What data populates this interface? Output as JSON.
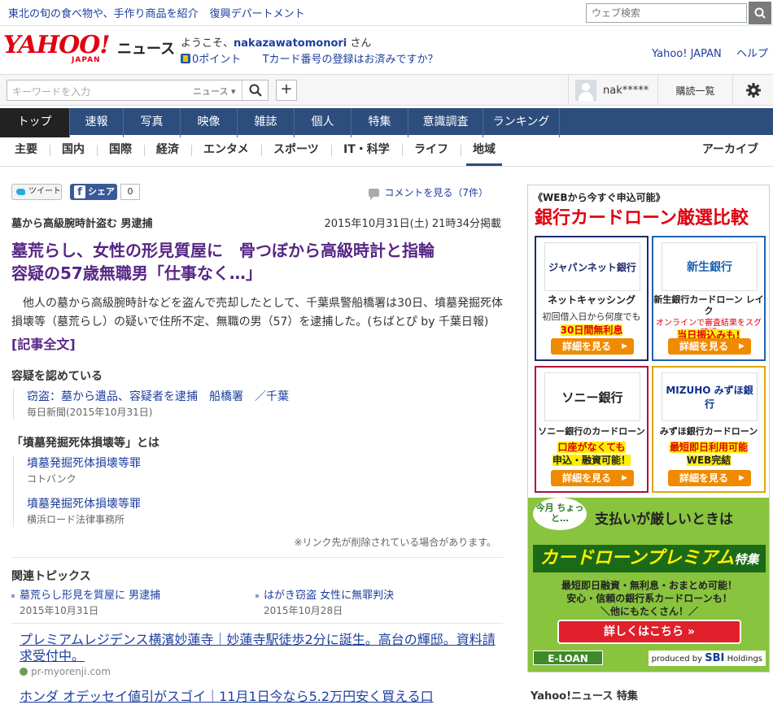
{
  "promo": {
    "text": "東北の旬の食べ物や、手作り商品を紹介",
    "link": "復興デパートメント"
  },
  "web_search": {
    "placeholder": "ウェブ検索"
  },
  "header": {
    "logo": "YAHOO!",
    "logo_sub": "JAPAN",
    "section": "ニュース",
    "welcome_prefix": "ようこそ、",
    "username": "nakazawatomonori",
    "welcome_suffix": " さん",
    "points": "0ポイント",
    "tcard": "Tカード番号の登録はお済みですか？",
    "links": [
      "Yahoo! JAPAN",
      "ヘルプ"
    ]
  },
  "toolbar": {
    "keyword_placeholder": "キーワードを入力",
    "category": "ニュース ▾",
    "user": "nak*****",
    "subscriptions": "購読一覧"
  },
  "nav": [
    {
      "label": "トップ",
      "w": 0
    },
    {
      "label": "速報"
    },
    {
      "label": "写真"
    },
    {
      "label": "映像"
    },
    {
      "label": "雑誌"
    },
    {
      "label": "個人"
    },
    {
      "label": "特集"
    },
    {
      "label": "意識調査"
    },
    {
      "label": "ランキング"
    }
  ],
  "subnav": [
    "主要",
    "国内",
    "国際",
    "経済",
    "エンタメ",
    "スポーツ",
    "IT・科学",
    "ライフ",
    "地域"
  ],
  "archive": "アーカイブ",
  "share": {
    "tweet": "ツイート",
    "facebook": "シェア",
    "fb_count": "0",
    "comments": "コメントを見る（7件）"
  },
  "article": {
    "kicker": "墓から高級腕時計盗む 男逮捕",
    "date": "2015年10月31日(土) 21時34分掲載",
    "title_line1": "墓荒らし、女性の形見質屋に　骨つぼから高級時計と指輪",
    "title_line2": "容疑の57歳無職男「仕事なく…」",
    "lead": "他人の墓から高級腕時計などを盗んで売却したとして、千葉県警船橋署は30日、墳墓発掘死体損壊等（墓荒らし）の疑いで住所不定、無職の男（57）を逮捕した。(ちばとぴ by 千葉日報)",
    "full_link": "[記事全文]"
  },
  "related": [
    {
      "heading": "容疑を認めている",
      "items": [
        {
          "link": "窃盗：墓から遺品、容疑者を逮捕　船橋署　／千葉",
          "source": "毎日新聞(2015年10月31日)"
        }
      ]
    },
    {
      "heading": "「墳墓発掘死体損壊等」とは",
      "items": [
        {
          "link": "墳墓発掘死体損壊等罪",
          "source": "コトバンク"
        },
        {
          "link": "墳墓発掘死体損壊等罪",
          "source": "横浜ロード法律事務所"
        }
      ]
    }
  ],
  "note": "※リンク先が削除されている場合があります。",
  "topics": {
    "heading": "関連トピックス",
    "items": [
      {
        "title": "墓荒らし形見を質屋に 男逮捕",
        "date": "2015年10月31日"
      },
      {
        "title": "はがき窃盗 女性に無罪判決",
        "date": "2015年10月28日"
      }
    ]
  },
  "ads": {
    "ad1_title": "プレミアムレジデンス横濱妙蓮寺｜妙蓮寺駅徒歩2分に誕生。高台の輝邸。資料請求受付中。",
    "ad1_url": "pr-myorenji.com",
    "ad2_title": "ホンダ オデッセイ値引がスゴイ｜11月1日今なら5.2万円安く買える口"
  },
  "side_ad": {
    "tag": "《WEBから今すぐ申込可能》",
    "headline": "銀行カードローン厳選比較",
    "cards": [
      {
        "logo": "ジャパンネット銀行",
        "name": "ネットキャッシング",
        "d1": "初回借入日から何度でも",
        "d2": "30日間無利息",
        "btn": "詳細を見る",
        "color": "#1d2a6b"
      },
      {
        "logo": "新生銀行",
        "name": "新生銀行カードローン レイク",
        "d1": "オンラインで審査結果をスグ確認",
        "d2": "当日振込みも!",
        "btn": "詳細を見る",
        "color": "#1d63b0"
      },
      {
        "logo": "ソニー銀行",
        "name": "ソニー銀行のカードローン",
        "d1": "口座がなくても",
        "d2": "申込・融資可能！",
        "btn": "詳細を見る",
        "color": "#b0103a"
      },
      {
        "logo": "MIZUHO みずほ銀行",
        "name": "みずほ銀行カードローン",
        "d1": "最短即日利用可能",
        "d2": "WEB完結",
        "btn": "詳細を見る",
        "color": "#e0a800"
      }
    ],
    "bubble": "今月 ちょっと…",
    "pay": "支払いが厳しいときは",
    "premium": "カードローンプレミアム",
    "premium_suffix": "特集",
    "text1": "最短即日融資・無利息・おまとめ可能！",
    "text2": "安心・信頼の銀行系カードローンも！",
    "text3": "＼他にもたくさん！／",
    "cta": "詳しくはこちら »",
    "eloan": "E-LOAN",
    "produced": "produced by",
    "sbi": "SBI",
    "sbi_sub": "Holdings"
  },
  "bottom_side": "Yahoo!ニュース 特集"
}
